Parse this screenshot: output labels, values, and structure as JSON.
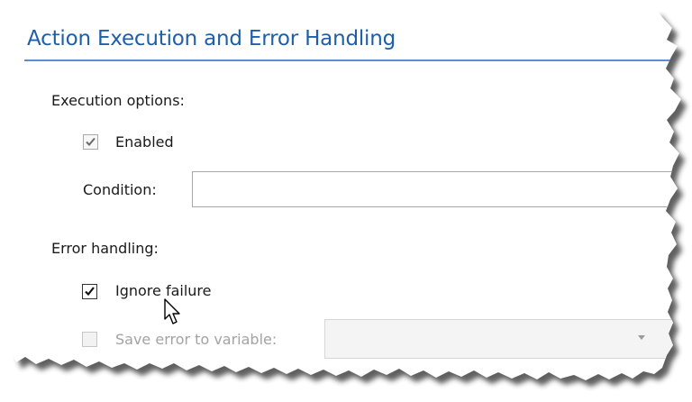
{
  "section": {
    "title": "Action Execution and Error Handling"
  },
  "execution": {
    "heading": "Execution options:",
    "enabled_label": "Enabled",
    "enabled_checked": true,
    "condition_label": "Condition:",
    "condition_value": ""
  },
  "error_handling": {
    "heading": "Error handling:",
    "ignore_failure_label": "Ignore failure",
    "ignore_failure_checked": true,
    "save_error_label": "Save error to variable:",
    "save_error_checked": false,
    "save_error_enabled": false,
    "variable_value": ""
  },
  "icons": {
    "checkmark": "check-icon",
    "dropdown": "chevron-down-icon",
    "cursor": "mouse-pointer-icon"
  },
  "colors": {
    "title": "#1f5fa8",
    "rule": "#5b8fd0",
    "disabled_text": "#a3a3a3"
  }
}
